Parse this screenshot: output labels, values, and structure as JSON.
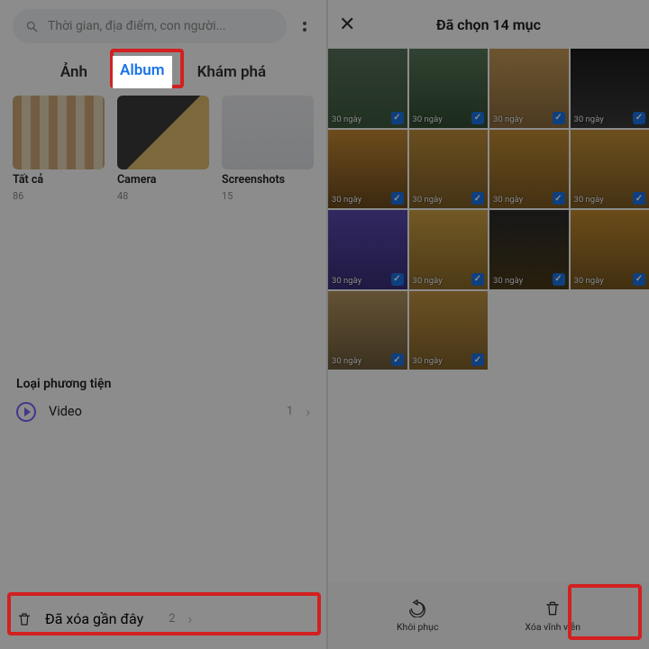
{
  "left": {
    "search_placeholder": "Thời gian, địa điểm, con người...",
    "tabs": {
      "photos": "Ảnh",
      "album": "Album",
      "explore": "Khám phá"
    },
    "albums": [
      {
        "name": "Tất cả",
        "count": "86"
      },
      {
        "name": "Camera",
        "count": "48"
      },
      {
        "name": "Screenshots",
        "count": "15"
      }
    ],
    "media_type_header": "Loại phương tiện",
    "video_row": {
      "label": "Video",
      "count": "1"
    },
    "trash_row": {
      "label": "Đã xóa gần đây",
      "count": "2"
    }
  },
  "right": {
    "title": "Đã chọn 14 mục",
    "cell_label": "30 ngày",
    "bottom": {
      "restore": "Khôi phục",
      "delete": "Xóa vĩnh viễn"
    }
  }
}
